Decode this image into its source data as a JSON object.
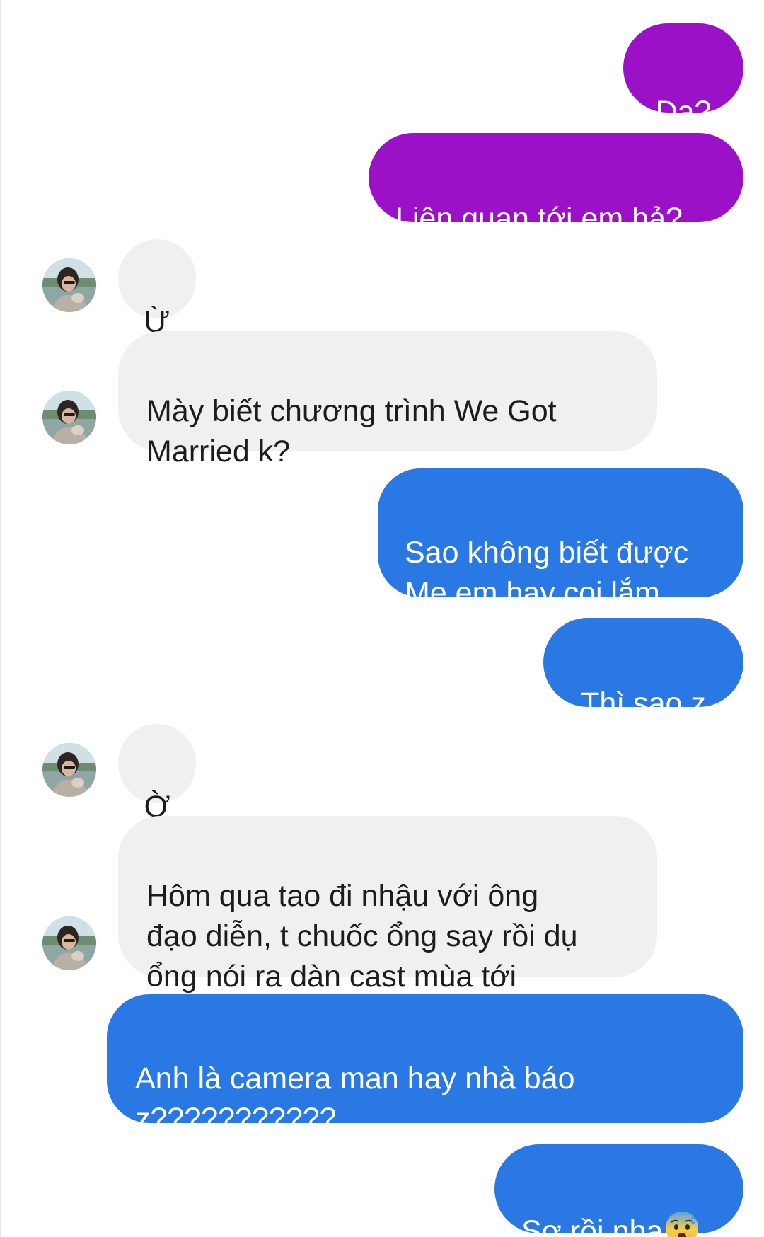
{
  "conversation": {
    "messages": [
      {
        "side": "sent",
        "text": "Dạ?"
      },
      {
        "side": "sent",
        "text": "Liên quan tới em hả?"
      },
      {
        "side": "received",
        "text": "Ừ"
      },
      {
        "side": "received",
        "text": "Mày biết chương trình We Got\nMarried k?"
      },
      {
        "side": "sent",
        "text": "Sao không biết được\nMẹ em hay coi lắm"
      },
      {
        "side": "sent",
        "text": "Thì sao z"
      },
      {
        "side": "received",
        "text": "Ờ"
      },
      {
        "side": "received",
        "text": "Hôm qua tao đi nhậu với ông\nđạo diễn, t chuốc ổng say rồi dụ\nổng nói ra dàn cast mùa tới"
      },
      {
        "side": "sent",
        "text": "Anh là camera man hay nhà báo\nz???????????"
      },
      {
        "side": "sent",
        "text": "Sợ rồi nha",
        "emoji": "anxious-face-with-sweat-icon"
      }
    ]
  },
  "colors": {
    "sent_purple": "#9b11c7",
    "sent_blue": "#2a78e4",
    "received_bg": "#f0f0f0",
    "received_text": "#1c1c1c"
  }
}
